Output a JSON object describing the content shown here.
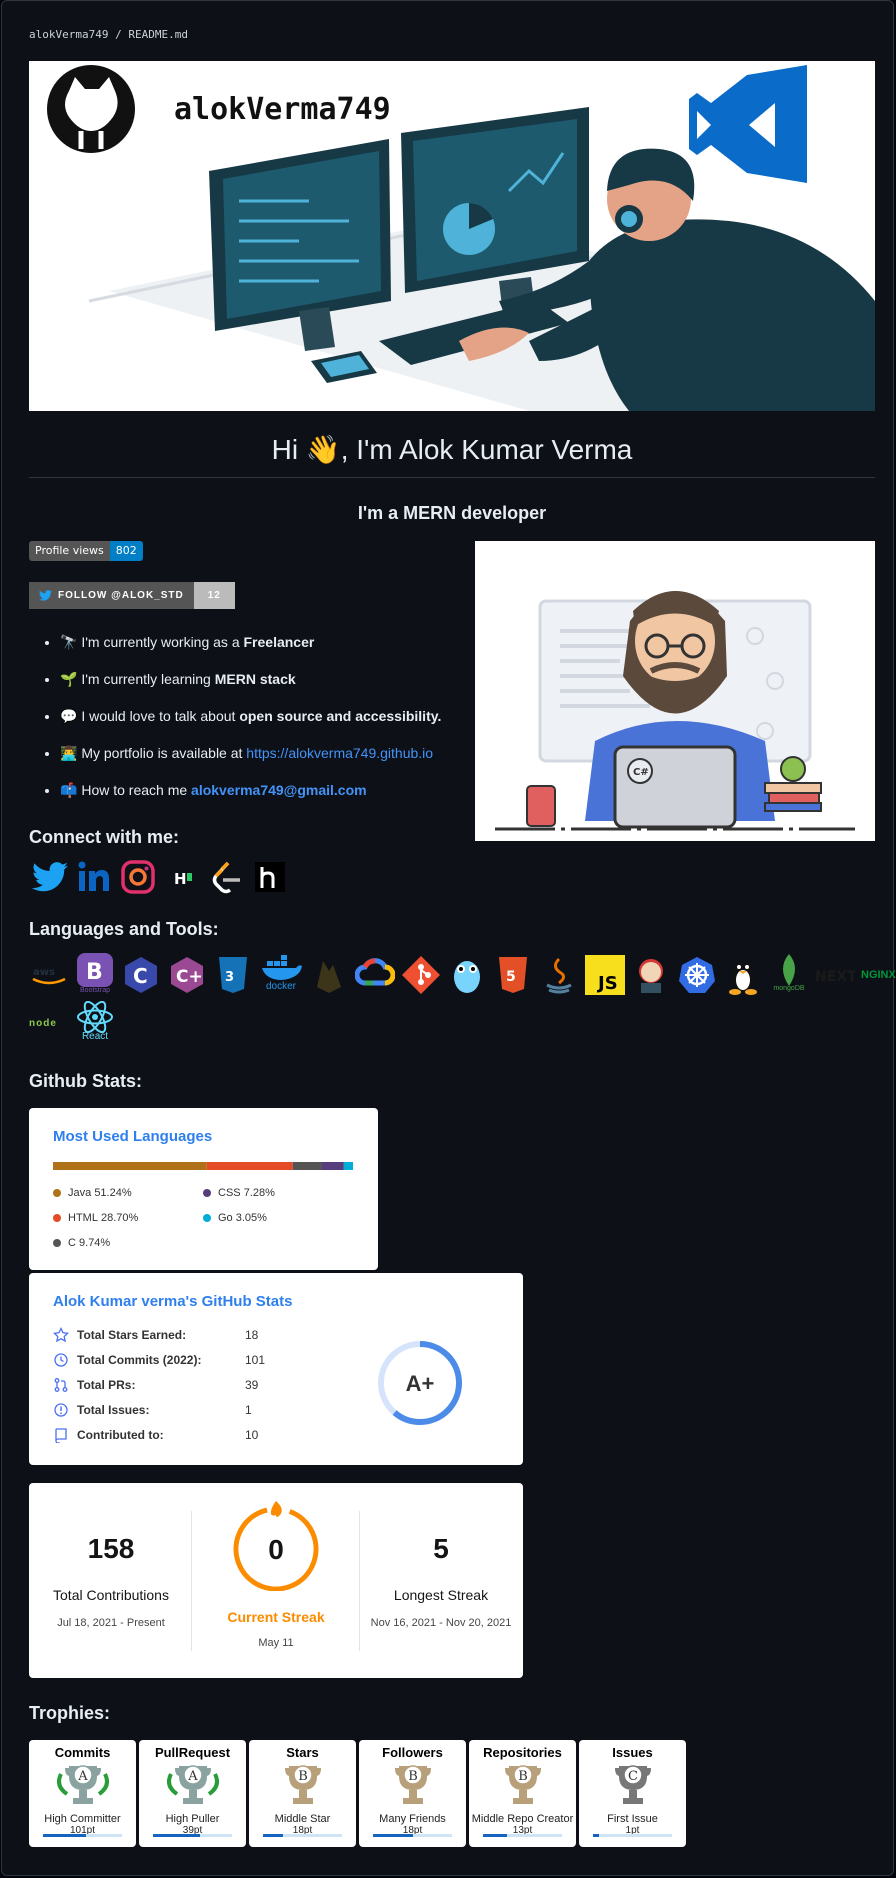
{
  "path": {
    "owner": "alokVerma749",
    "sep": " / ",
    "file": "README.md"
  },
  "banner": {
    "name": "alokVerma749"
  },
  "title": "Hi 👋, I'm Alok Kumar Verma",
  "subtitle": "I'm a MERN developer",
  "views_badge": {
    "label": "Profile views",
    "count": "802"
  },
  "twitter_badge": {
    "label": "FOLLOW @ALOK_STD",
    "count": "12"
  },
  "bullets": [
    {
      "emoji": "🔭",
      "pre": "I'm currently working as a ",
      "strong": "Freelancer",
      "link": ""
    },
    {
      "emoji": "🌱",
      "pre": "I'm currently learning ",
      "strong": "MERN stack",
      "link": ""
    },
    {
      "emoji": "💬",
      "pre": "I would love to talk about ",
      "strong": "open source and accessibility.",
      "link": ""
    },
    {
      "emoji": "👨‍💻",
      "pre": "My portfolio is available at ",
      "strong": "",
      "link": "https://alokverma749.github.io"
    },
    {
      "emoji": "📫",
      "pre": "How to reach me ",
      "strong": "",
      "link": "alokverma749@gmail.com"
    }
  ],
  "connect_heading": "Connect with me:",
  "social": [
    "twitter-icon",
    "linkedin-icon",
    "instagram-icon",
    "hackerrank-icon",
    "leetcode-icon",
    "hashnode-icon"
  ],
  "languages_heading": "Languages and Tools:",
  "tools": [
    "Bootstrap",
    "docker",
    "mongoDB",
    "NGINX",
    "node",
    "React"
  ],
  "stats_heading": "Github Stats:",
  "langs_card": {
    "title": "Most Used Languages",
    "langs": [
      {
        "name": "Java",
        "pct": "51.24%",
        "value": 51.24,
        "color": "#b07219"
      },
      {
        "name": "HTML",
        "pct": "28.70%",
        "value": 28.7,
        "color": "#e34c26"
      },
      {
        "name": "C",
        "pct": "9.74%",
        "value": 9.74,
        "color": "#555555"
      },
      {
        "name": "CSS",
        "pct": "7.28%",
        "value": 7.28,
        "color": "#563d7c"
      },
      {
        "name": "Go",
        "pct": "3.05%",
        "value": 3.05,
        "color": "#00add8"
      }
    ]
  },
  "stats_card": {
    "title": "Alok Kumar verma's GitHub Stats",
    "rows": [
      {
        "label": "Total Stars Earned:",
        "value": "18",
        "icon": "star-icon"
      },
      {
        "label": "Total Commits (2022):",
        "value": "101",
        "icon": "history-icon"
      },
      {
        "label": "Total PRs:",
        "value": "39",
        "icon": "pull-request-icon"
      },
      {
        "label": "Total Issues:",
        "value": "1",
        "icon": "issue-icon"
      },
      {
        "label": "Contributed to:",
        "value": "10",
        "icon": "repo-icon"
      }
    ],
    "grade": "A+"
  },
  "streak_card": {
    "total": "158",
    "total_label": "Total Contributions",
    "total_range": "Jul 18, 2021 - Present",
    "current": "0",
    "current_label": "Current Streak",
    "current_date": "May 11",
    "longest": "5",
    "longest_label": "Longest Streak",
    "longest_range": "Nov 16, 2021 - Nov 20, 2021"
  },
  "trophies_heading": "Trophies:",
  "trophies": [
    {
      "title": "Commits",
      "rank": "A",
      "name": "High Committer",
      "pts": "101pt",
      "progress": 0.55,
      "color": "#8aa3a0"
    },
    {
      "title": "PullRequest",
      "rank": "A",
      "name": "High Puller",
      "pts": "39pt",
      "progress": 0.6,
      "color": "#8aa3a0"
    },
    {
      "title": "Stars",
      "rank": "B",
      "name": "Middle Star",
      "pts": "18pt",
      "progress": 0.25,
      "color": "#b8a07a"
    },
    {
      "title": "Followers",
      "rank": "B",
      "name": "Many Friends",
      "pts": "18pt",
      "progress": 0.5,
      "color": "#b8a07a"
    },
    {
      "title": "Repositories",
      "rank": "B",
      "name": "Middle Repo Creator",
      "pts": "13pt",
      "progress": 0.3,
      "color": "#b8a07a"
    },
    {
      "title": "Issues",
      "rank": "C",
      "name": "First Issue",
      "pts": "1pt",
      "progress": 0.08,
      "color": "#777"
    }
  ],
  "colors": {
    "bg": "#0d1117",
    "link": "#4493f8",
    "stats_title": "#2f80ed",
    "streak": "#fb8c00"
  }
}
